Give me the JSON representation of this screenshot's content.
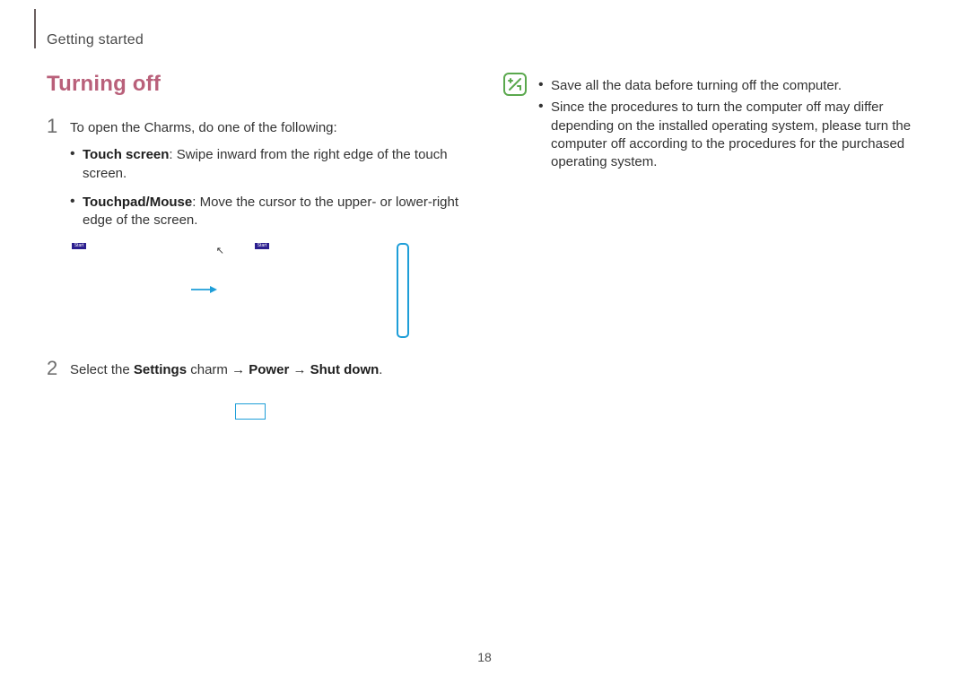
{
  "header": "Getting started",
  "section_title": "Turning off",
  "step1": {
    "num": "1",
    "text": "To open the Charms, do one of the following:",
    "bullets": [
      {
        "label": "Touch screen",
        "rest": ": Swipe inward from the right edge of the touch screen."
      },
      {
        "label": "Touchpad/Mouse",
        "rest": ": Move the cursor to the upper- or lower-right edge of the screen."
      }
    ],
    "start_label": "Start"
  },
  "step2": {
    "num": "2",
    "prefix": "Select the ",
    "settings": "Settings",
    "mid1": " charm → ",
    "power": "Power",
    "mid2": " → ",
    "shutdown": "Shut down",
    "suffix": "."
  },
  "notes": [
    "Save all the data before turning off the computer.",
    "Since the procedures to turn the computer off may differ depending on the installed operating system, please turn the computer off according to the procedures for the purchased operating system."
  ],
  "page_number": "18"
}
